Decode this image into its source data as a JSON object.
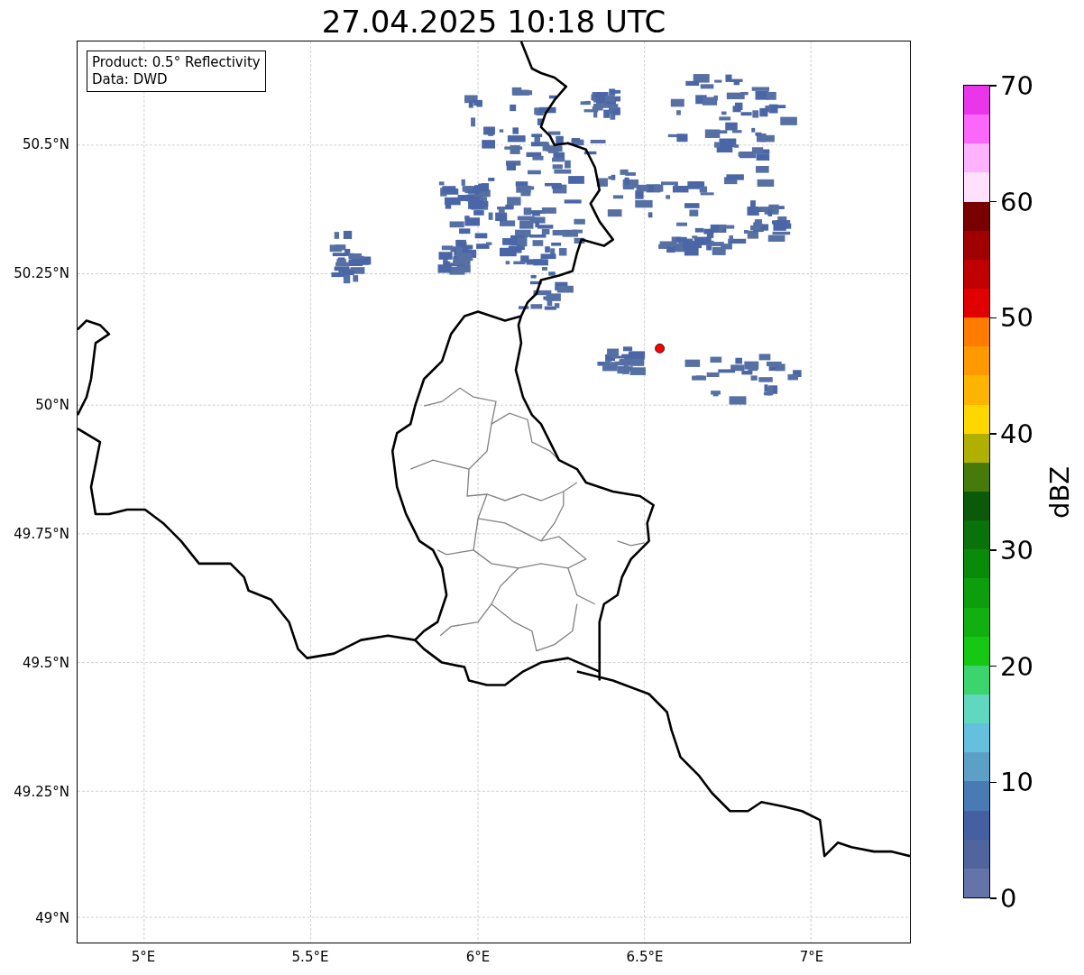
{
  "title": "27.04.2025 10:18 UTC",
  "info_box": {
    "lines": [
      "Product: 0.5° Reflectivity",
      "Data: DWD"
    ]
  },
  "map": {
    "x_ticks": [
      "5°E",
      "5.5°E",
      "6°E",
      "6.5°E",
      "7°E"
    ],
    "y_ticks": [
      "50.5°N",
      "50.25°N",
      "50°N",
      "49.75°N",
      "49.5°N",
      "49.25°N",
      "49°N"
    ]
  },
  "colorbar": {
    "label": "dBZ",
    "ticks": [
      "70",
      "60",
      "50",
      "40",
      "30",
      "20",
      "10",
      "0"
    ],
    "bands": [
      {
        "color": "#e836e8"
      },
      {
        "color": "#fb66fb"
      },
      {
        "color": "#ffb3ff"
      },
      {
        "color": "#ffe0ff"
      },
      {
        "color": "#780000"
      },
      {
        "color": "#a00000"
      },
      {
        "color": "#c00000"
      },
      {
        "color": "#e00000"
      },
      {
        "color": "#ff7c00"
      },
      {
        "color": "#ff9900"
      },
      {
        "color": "#ffb500"
      },
      {
        "color": "#ffd700"
      },
      {
        "color": "#b0b000"
      },
      {
        "color": "#467a0a"
      },
      {
        "color": "#0a5a0a"
      },
      {
        "color": "#0a720a"
      },
      {
        "color": "#0a8a0a"
      },
      {
        "color": "#0c9e0c"
      },
      {
        "color": "#10b010"
      },
      {
        "color": "#14c814"
      },
      {
        "color": "#3cd46c"
      },
      {
        "color": "#60d8c0"
      },
      {
        "color": "#64c0dc"
      },
      {
        "color": "#5ca0c8"
      },
      {
        "color": "#4a7ab4"
      },
      {
        "color": "#4460a0"
      },
      {
        "color": "#50649e"
      },
      {
        "color": "#6474a8"
      }
    ]
  }
}
